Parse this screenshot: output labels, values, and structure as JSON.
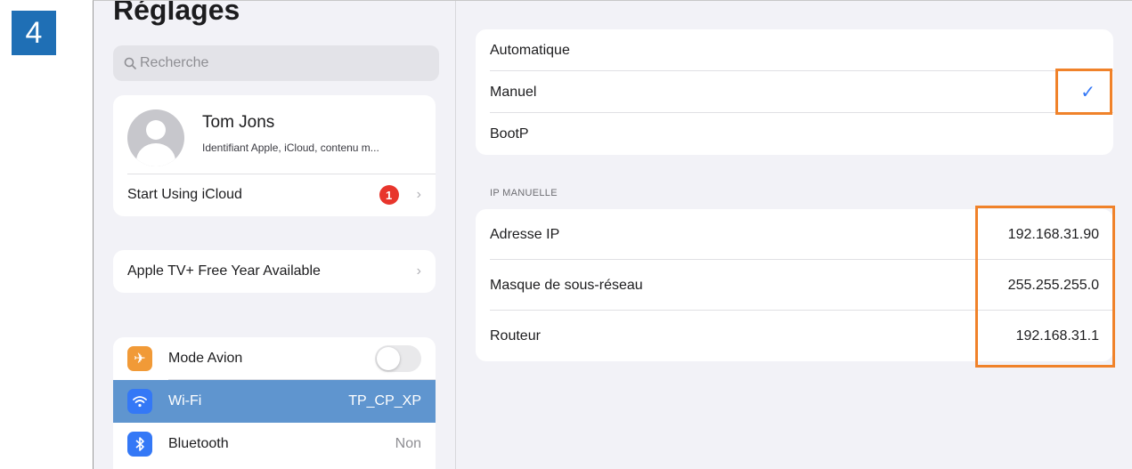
{
  "step": "4",
  "sidebar": {
    "title": "Réglages",
    "search_placeholder": "Recherche",
    "profile": {
      "name": "Tom Jons",
      "subtitle": "Identifiant Apple, iCloud, contenu m...",
      "icloud_label": "Start Using iCloud",
      "icloud_badge": "1"
    },
    "appletv_label": "Apple TV+ Free Year Available",
    "items": [
      {
        "label": "Mode Avion",
        "icon": "airplane-icon",
        "color": "#f19a37"
      },
      {
        "label": "Wi-Fi",
        "value": "TP_CP_XP",
        "icon": "wifi-icon",
        "color": "#3478f6"
      },
      {
        "label": "Bluetooth",
        "value": "Non",
        "icon": "bluetooth-icon",
        "color": "#3478f6"
      }
    ]
  },
  "detail": {
    "config_options": [
      "Automatique",
      "Manuel",
      "BootP"
    ],
    "selected_option": "Manuel",
    "section_header": "IP MANUELLE",
    "fields": [
      {
        "label": "Adresse IP",
        "value": "192.168.31.90"
      },
      {
        "label": "Masque de sous-réseau",
        "value": "255.255.255.0"
      },
      {
        "label": "Routeur",
        "value": "192.168.31.1"
      }
    ]
  },
  "colors": {
    "highlight": "#f0822a",
    "step_badge": "#1f6fb5",
    "selected_row": "#5f95cf",
    "checkmark": "#3478f6"
  }
}
